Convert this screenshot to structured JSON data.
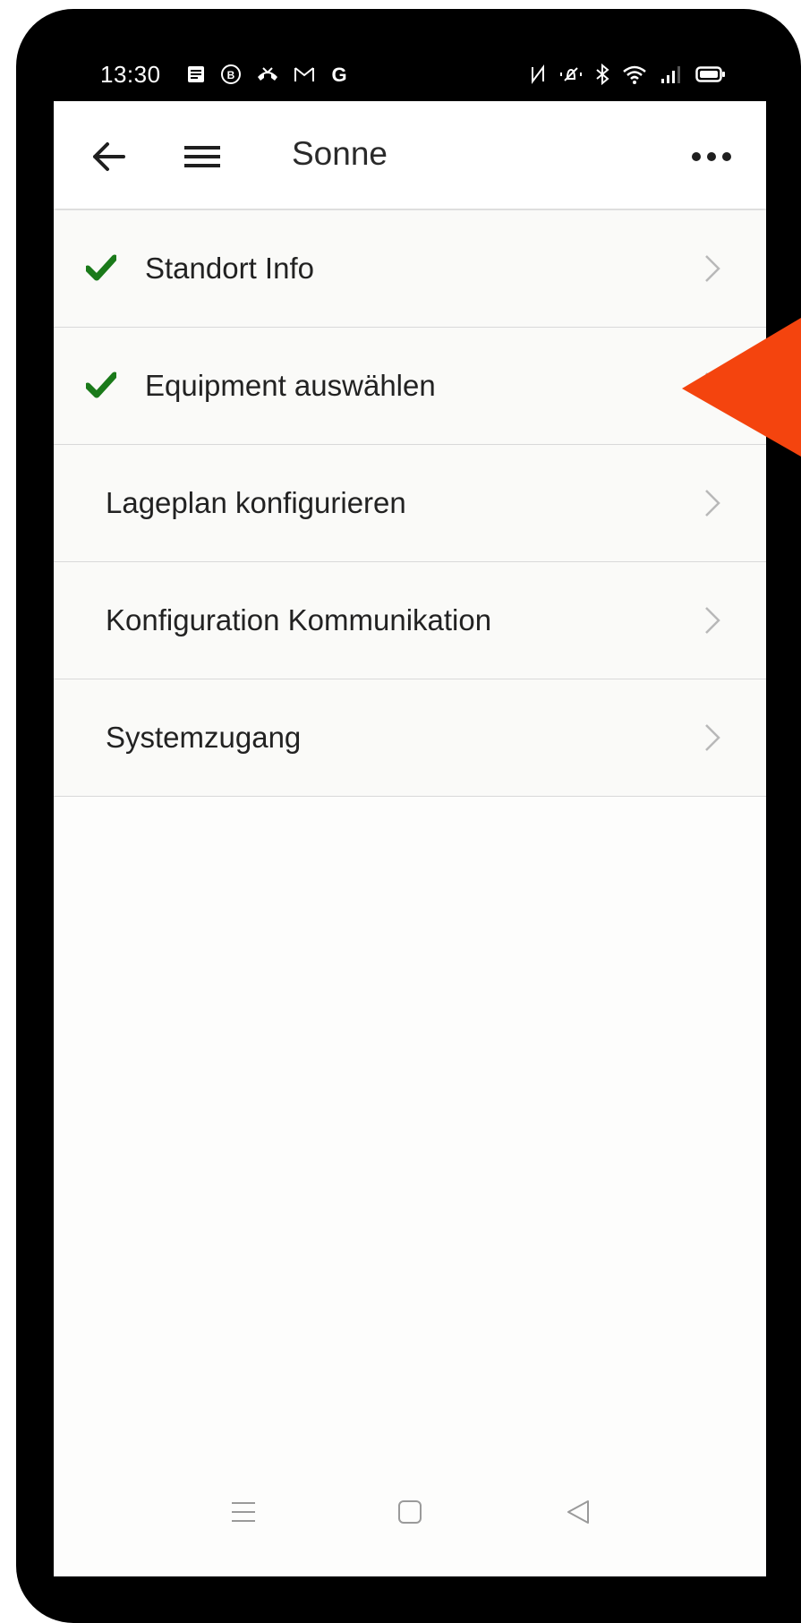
{
  "status_bar": {
    "time": "13:30",
    "left_icons": [
      "news-icon",
      "b-circle-icon",
      "missed-call-icon",
      "gmail-icon",
      "google-icon"
    ],
    "right_icons": [
      "nfc-icon",
      "vibrate-icon",
      "bluetooth-icon",
      "wifi-icon",
      "signal-icon",
      "battery-icon"
    ]
  },
  "app_bar": {
    "title": "Sonne"
  },
  "list": [
    {
      "label": "Standort Info",
      "checked": true
    },
    {
      "label": "Equipment auswählen",
      "checked": true
    },
    {
      "label": "Lageplan konfigurieren",
      "checked": false
    },
    {
      "label": "Konfiguration Kommunikation",
      "checked": false
    },
    {
      "label": "Systemzugang",
      "checked": false
    }
  ],
  "colors": {
    "check": "#1a7a1a",
    "arrow": "#f4440e",
    "chevron": "#b8b8b8"
  }
}
